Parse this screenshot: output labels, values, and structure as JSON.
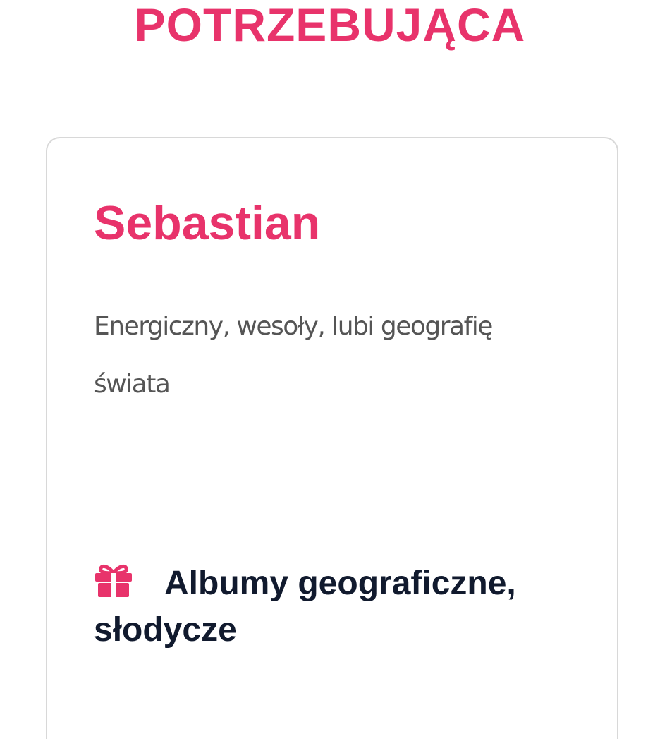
{
  "header": {
    "title": "POTRZEBUJĄCA"
  },
  "card": {
    "name": "Sebastian",
    "description": "Energiczny, wesoły, lubi geografię świata",
    "gift": {
      "icon": "gift-icon",
      "text": "Albumy geograficzne, słodycze"
    }
  },
  "colors": {
    "accent": "#e8336b",
    "text_dark": "#111a2e",
    "text_muted": "#555555",
    "border": "#d8d8d8"
  }
}
